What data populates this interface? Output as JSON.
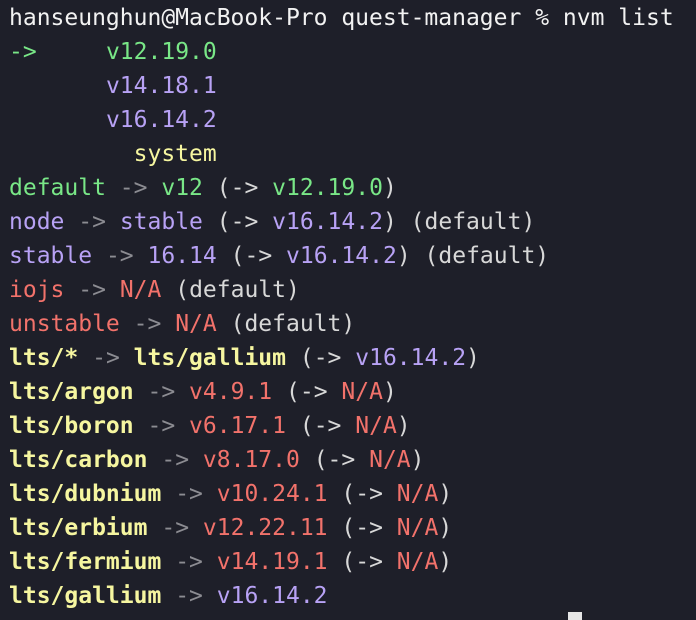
{
  "terminal": {
    "prompt": "hanseunghun@MacBook-Pro quest-manager % nvm list",
    "current_marker": "->",
    "installed_versions": [
      "v12.19.0",
      "v14.18.1",
      "v16.14.2"
    ],
    "system_label": "system",
    "aliases": [
      {
        "name": "default",
        "target": "v12",
        "resolved": "v12.19.0",
        "note": ""
      },
      {
        "name": "node",
        "target": "stable",
        "resolved": "v16.14.2",
        "note": "(default)"
      },
      {
        "name": "stable",
        "target": "16.14",
        "resolved": "v16.14.2",
        "note": "(default)"
      },
      {
        "name": "iojs",
        "target": "N/A",
        "resolved": "",
        "note": "(default)"
      },
      {
        "name": "unstable",
        "target": "N/A",
        "resolved": "",
        "note": "(default)"
      },
      {
        "name": "lts/*",
        "target": "lts/gallium",
        "resolved": "v16.14.2",
        "note": ""
      },
      {
        "name": "lts/argon",
        "target": "v4.9.1",
        "resolved": "N/A",
        "note": ""
      },
      {
        "name": "lts/boron",
        "target": "v6.17.1",
        "resolved": "N/A",
        "note": ""
      },
      {
        "name": "lts/carbon",
        "target": "v8.17.0",
        "resolved": "N/A",
        "note": ""
      },
      {
        "name": "lts/dubnium",
        "target": "v10.24.1",
        "resolved": "N/A",
        "note": ""
      },
      {
        "name": "lts/erbium",
        "target": "v12.22.11",
        "resolved": "N/A",
        "note": ""
      },
      {
        "name": "lts/fermium",
        "target": "v14.19.1",
        "resolved": "N/A",
        "note": ""
      },
      {
        "name": "lts/gallium",
        "target": "v16.14.2",
        "resolved": "",
        "note": ""
      }
    ],
    "arrow": "->",
    "arrow_resolve": "(->",
    "close_paren": ")"
  },
  "colors": {
    "background": "#1e1f29",
    "green": "#79e787",
    "purple": "#b8a2f5",
    "yellow": "#f6f6a0",
    "red": "#f2726b",
    "gray": "#d8d8d8",
    "arrow": "#8c8c92"
  }
}
